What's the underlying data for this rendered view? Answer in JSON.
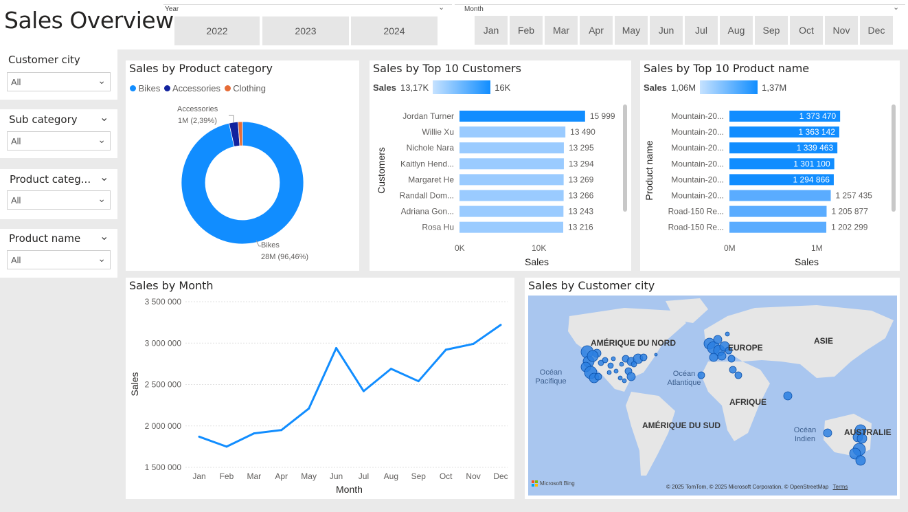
{
  "header": {
    "title": "Sales Overview"
  },
  "year_slicer": {
    "label": "Year",
    "options": [
      "2022",
      "2023",
      "2024"
    ]
  },
  "month_slicer": {
    "label": "Month",
    "options": [
      "Jan",
      "Feb",
      "Mar",
      "Apr",
      "May",
      "Jun",
      "Jul",
      "Aug",
      "Sep",
      "Oct",
      "Nov",
      "Dec"
    ]
  },
  "filters": [
    {
      "label": "Customer city",
      "value": "All"
    },
    {
      "label": "Sub category",
      "value": "All"
    },
    {
      "label": "Product categ...",
      "value": "All"
    },
    {
      "label": "Product name",
      "value": "All"
    }
  ],
  "colors": {
    "primary": "#118DFF",
    "navy": "#12239E",
    "orange": "#E66C37",
    "light": "#8CC6FF"
  },
  "donut": {
    "title": "Sales by Product category",
    "legend": [
      "Bikes",
      "Accessories",
      "Clothing"
    ],
    "accessories_label": "Accessories",
    "accessories_value": "1M (2,39%)",
    "bikes_label": "Bikes",
    "bikes_value": "28M (96,46%)"
  },
  "customers": {
    "title": "Sales by Top 10 Customers",
    "scale_label": "Sales",
    "scale_min": "13,17K",
    "scale_max": "16K",
    "ylabel": "Customers",
    "xlabel": "Sales",
    "ticks": [
      "0K",
      "10K"
    ]
  },
  "products": {
    "title": "Sales by Top 10 Product name",
    "scale_label": "Sales",
    "scale_min": "1,06M",
    "scale_max": "1,37M",
    "ylabel": "Product name",
    "xlabel": "Sales",
    "ticks": [
      "0M",
      "1M"
    ]
  },
  "monthly": {
    "title": "Sales by Month",
    "ylabel": "Sales",
    "xlabel": "Month",
    "yticks": [
      "3 500 000",
      "3 000 000",
      "2 500 000",
      "2 000 000",
      "1 500 000"
    ]
  },
  "map": {
    "title": "Sales by Customer city",
    "labels": [
      "AMÉRIQUE DU NORD",
      "EUROPE",
      "ASIE",
      "AFRIQUE",
      "AMÉRIQUE DU SUD",
      "AUSTRALIE"
    ],
    "oceans": [
      "Océan Pacifique",
      "Océan Atlantique",
      "Océan Indien"
    ],
    "attribution": "© 2025 TomTom, © 2025 Microsoft Corporation, © OpenStreetMap",
    "terms": "Terms",
    "brand": "Microsoft Bing"
  },
  "chart_data": [
    {
      "type": "pie",
      "title": "Sales by Product category",
      "categories": [
        "Bikes",
        "Accessories",
        "Clothing"
      ],
      "values": [
        96.46,
        2.39,
        1.15
      ],
      "labels": [
        "28M (96,46%)",
        "1M (2,39%)",
        ""
      ]
    },
    {
      "type": "bar",
      "title": "Sales by Top 10 Customers",
      "categories": [
        "Jordan Turner",
        "Willie Xu",
        "Nichole Nara",
        "Kaitlyn Hend...",
        "Margaret He",
        "Randall Dom...",
        "Adriana Gon...",
        "Rosa Hu"
      ],
      "values": [
        15999,
        13490,
        13295,
        13294,
        13269,
        13266,
        13243,
        13216
      ],
      "value_labels": [
        "15 999",
        "13 490",
        "13 295",
        "13 294",
        "13 269",
        "13 266",
        "13 243",
        "13 216"
      ],
      "xlabel": "Sales",
      "ylabel": "Customers",
      "xlim": [
        0,
        17500
      ]
    },
    {
      "type": "bar",
      "title": "Sales by Top 10 Product name",
      "categories": [
        "Mountain-20...",
        "Mountain-20...",
        "Mountain-20...",
        "Mountain-20...",
        "Mountain-20...",
        "Mountain-20...",
        "Road-150 Re...",
        "Road-150 Re..."
      ],
      "values": [
        1373470,
        1363142,
        1339463,
        1301100,
        1294866,
        1257435,
        1205877,
        1202299
      ],
      "value_labels": [
        "1 373 470",
        "1 363 142",
        "1 339 463",
        "1 301 100",
        "1 294 866",
        "1 257 435",
        "1 205 877",
        "1 202 299"
      ],
      "xlabel": "Sales",
      "ylabel": "Product name",
      "xlim": [
        0,
        1500000
      ]
    },
    {
      "type": "line",
      "title": "Sales by Month",
      "x": [
        "Jan",
        "Feb",
        "Mar",
        "Apr",
        "May",
        "Jun",
        "Jul",
        "Aug",
        "Sep",
        "Oct",
        "Nov",
        "Dec"
      ],
      "series": [
        {
          "values": [
            1870000,
            1750000,
            1910000,
            1950000,
            2210000,
            2940000,
            2420000,
            2690000,
            2540000,
            2920000,
            2990000,
            3220000
          ]
        }
      ],
      "xlabel": "Month",
      "ylabel": "Sales",
      "ylim": [
        1500000,
        3500000
      ]
    }
  ]
}
